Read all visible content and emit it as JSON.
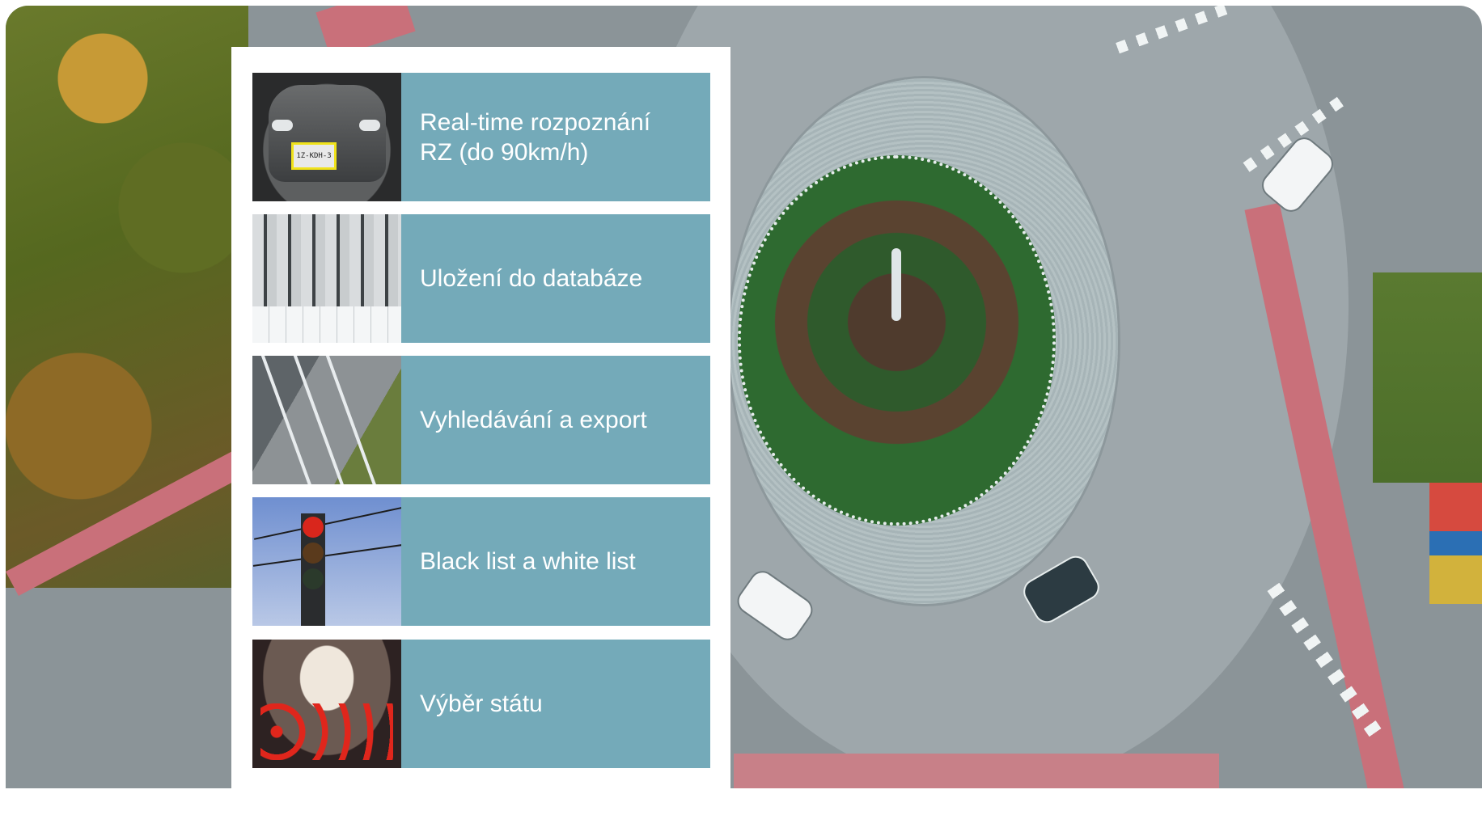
{
  "features": [
    {
      "id": "plate-recognition",
      "label": "Real-time rozpoznání\nRZ (do 90km/h)",
      "plate_text": "1Z-KDH-3"
    },
    {
      "id": "database",
      "label": "Uložení do databáze"
    },
    {
      "id": "search-export",
      "label": "Vyhledávání a export"
    },
    {
      "id": "lists",
      "label": "Black list a white list"
    },
    {
      "id": "country",
      "label": "Výběr státu"
    }
  ],
  "colors": {
    "label_background": "#74aab9",
    "label_text": "#ffffff",
    "panel_background": "#ffffff"
  },
  "icons": {
    "thumb_1": "car-license-plate-photo",
    "thumb_2": "server-room-photo",
    "thumb_3": "highway-photo",
    "thumb_4": "traffic-light-photo",
    "thumb_5": "tunnel-traffic-photo"
  }
}
